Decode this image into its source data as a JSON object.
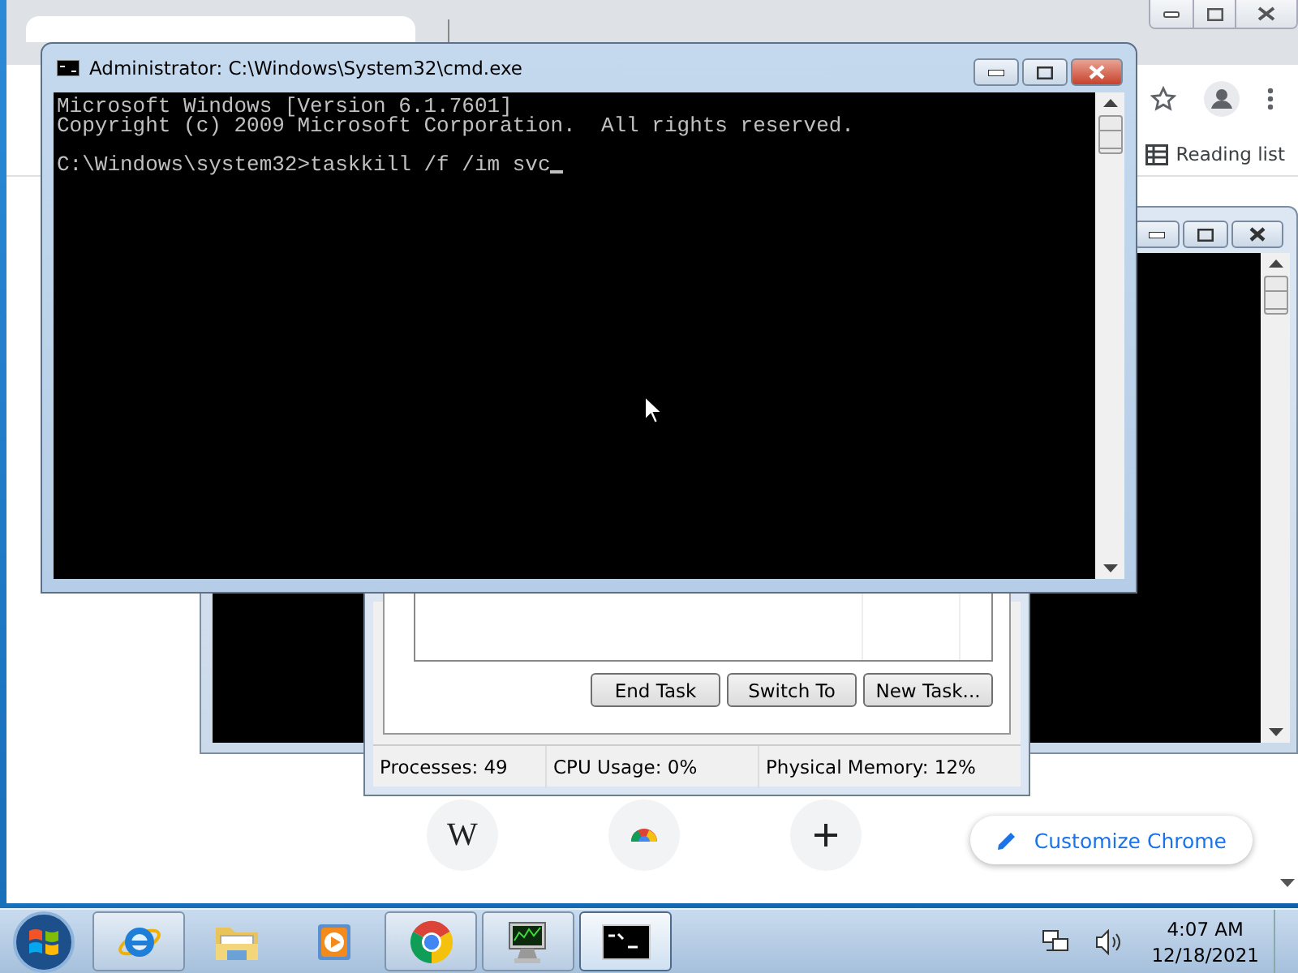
{
  "chrome_window": {
    "bookmarks_bar": {
      "reading_list": "Reading list"
    },
    "shortcuts": [
      {
        "kind": "letter",
        "label": "W"
      },
      {
        "kind": "chrome"
      },
      {
        "kind": "add"
      }
    ],
    "customize_button": "Customize Chrome"
  },
  "task_manager": {
    "buttons": [
      "End Task",
      "Switch To",
      "New Task..."
    ],
    "status_bar": [
      "Processes: 49",
      "CPU Usage: 0%",
      "Physical Memory: 12%"
    ]
  },
  "console": {
    "title": "Administrator: C:\\Windows\\System32\\cmd.exe",
    "output": [
      "Microsoft Windows [Version 6.1.7601]",
      "Copyright (c) 2009 Microsoft Corporation.  All rights reserved."
    ],
    "input_line": "C:\\Windows\\system32>taskkill /f /im svc"
  },
  "taskbar": {
    "apps": [
      {
        "kind": "internet-explorer",
        "running": true,
        "selected": false
      },
      {
        "kind": "file-explorer",
        "running": false,
        "selected": false
      },
      {
        "kind": "media-player",
        "running": false,
        "selected": false
      },
      {
        "kind": "chrome",
        "running": true,
        "selected": false
      },
      {
        "kind": "task-manager",
        "running": true,
        "selected": false
      },
      {
        "kind": "console",
        "running": true,
        "selected": true
      }
    ],
    "clock": {
      "time": "4:07 AM",
      "date": "12/18/2021"
    }
  }
}
